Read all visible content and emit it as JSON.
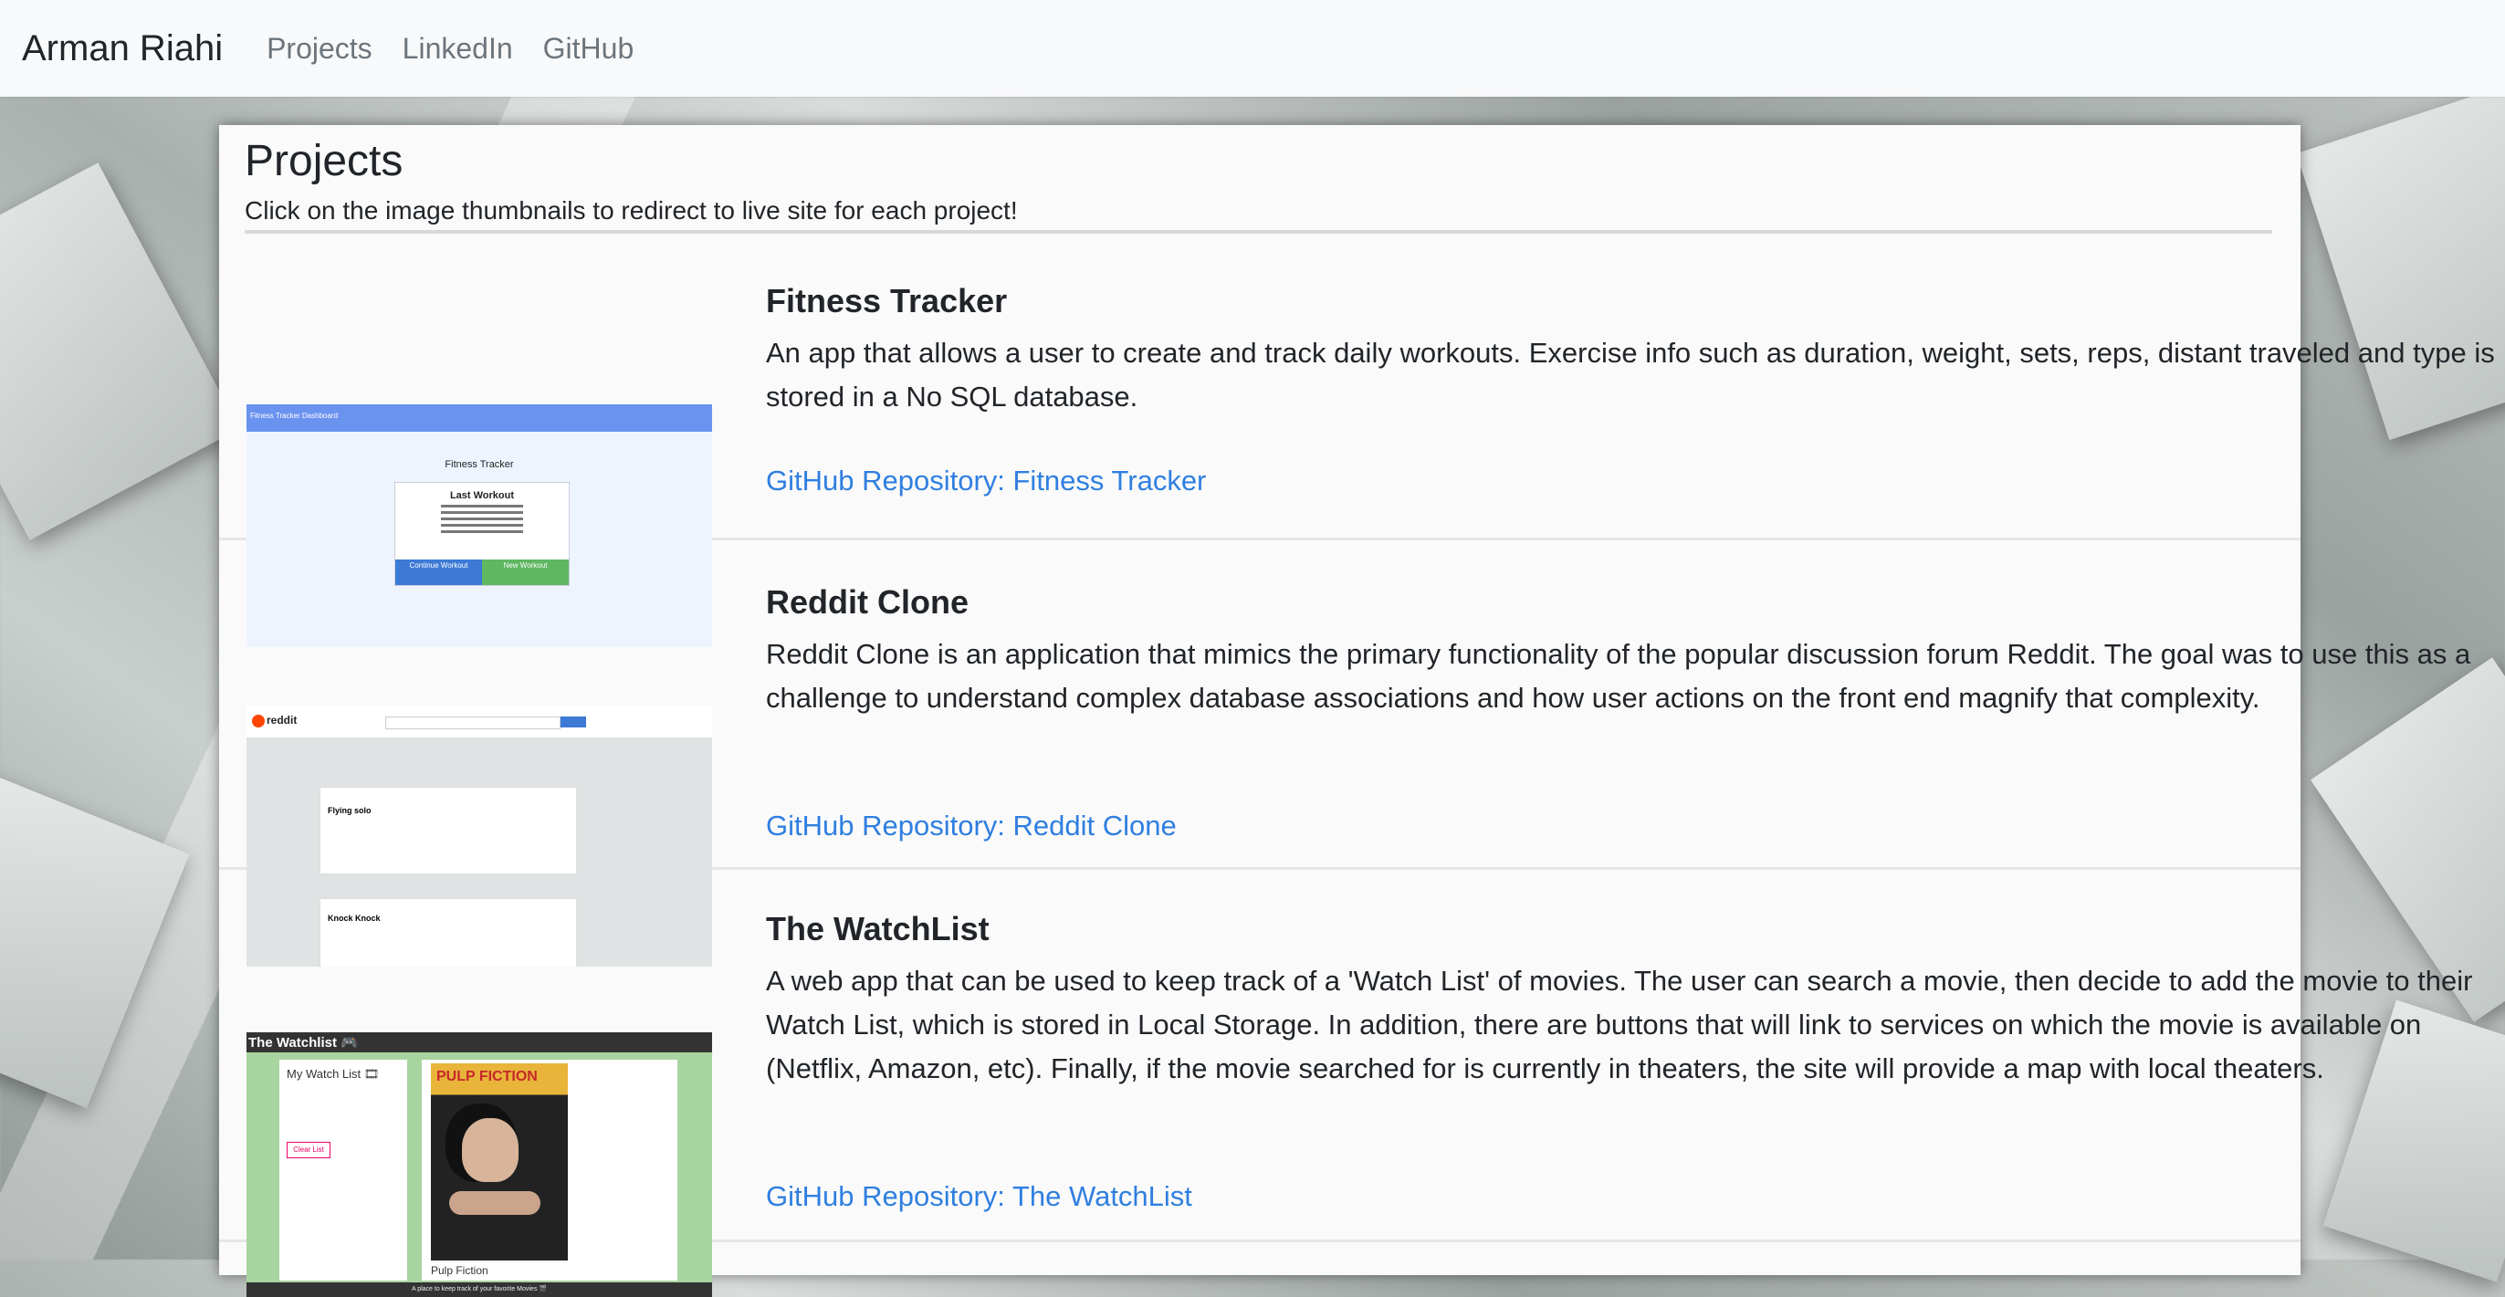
{
  "navbar": {
    "brand": "Arman Riahi",
    "links": [
      "Projects",
      "LinkedIn",
      "GitHub"
    ]
  },
  "page": {
    "title": "Projects",
    "subtitle": "Click on the image thumbnails to redirect to live site for each project!"
  },
  "projects": [
    {
      "title": "Fitness Tracker",
      "description": "An app that allows a user to create and track daily workouts. Exercise info such as duration, weight, sets, reps, distant traveled and type is stored in a No SQL database.",
      "link": "GitHub Repository: Fitness Tracker",
      "thumb": {
        "header": "Fitness Tracker Dashboard",
        "heading": "Fitness Tracker",
        "card_title": "Last Workout",
        "button_left": "Continue Workout",
        "button_right": "New Workout"
      }
    },
    {
      "title": "Reddit Clone",
      "description": "Reddit Clone is an application that mimics the primary functionality of the popular discussion forum Reddit. The goal was to use this as a challenge to understand complex database associations and how user actions on the front end magnify that complexity.",
      "link": "GitHub Repository: Reddit Clone",
      "thumb": {
        "logo": "reddit",
        "post1_title": "Flying solo",
        "post2_title": "Knock Knock"
      }
    },
    {
      "title": "The WatchList",
      "description": "A web app that can be used to keep track of a 'Watch List' of movies. The user can search a movie, then decide to add the movie to their Watch List, which is stored in Local Storage. In addition, there are buttons that will link to services on which the movie is available on (Netflix, Amazon, etc). Finally, if the movie searched for is currently in theaters, the site will provide a map with local theaters.",
      "link": "GitHub Repository: The WatchList",
      "thumb": {
        "header": "The Watchlist 🎮",
        "panel_title": "My Watch List 🎞",
        "clear": "Clear List",
        "poster_title": "PULP FICTION",
        "movie": "Pulp Fiction",
        "footer": "A place to keep track of your favorite Movies 🎬"
      }
    }
  ],
  "colors": {
    "link": "#2f7fe0",
    "navbar_bg": "#f8f9fa",
    "brand_text": "#212529",
    "nav_text": "#6c757d"
  }
}
